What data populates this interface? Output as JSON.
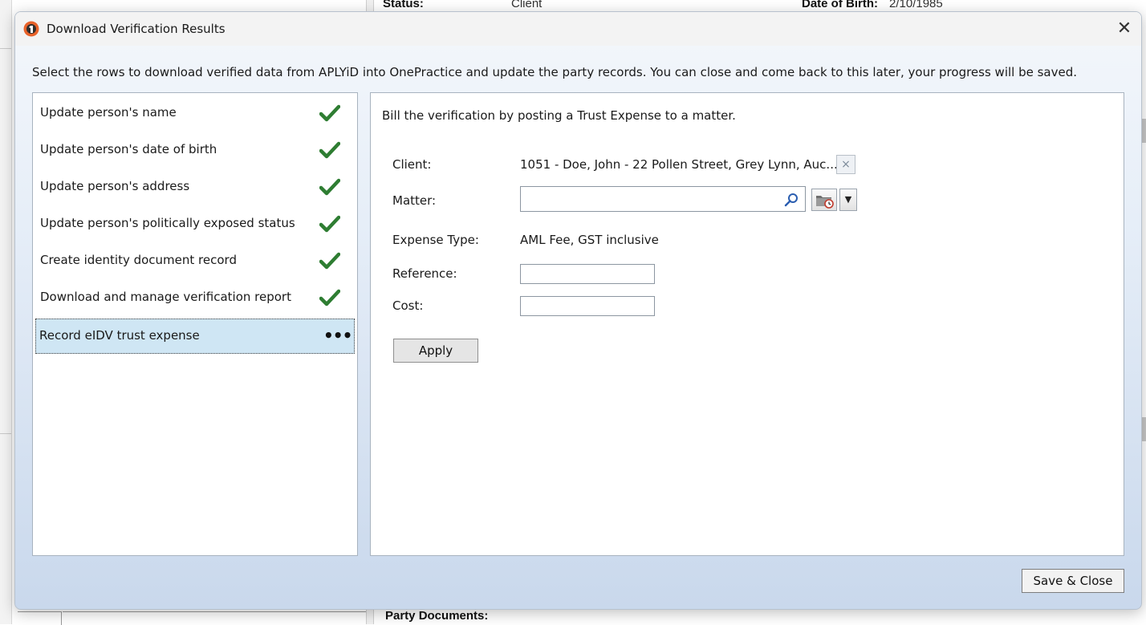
{
  "background": {
    "status_label": "Status:",
    "status_value": "Client",
    "dob_label": "Date of Birth:",
    "dob_value": "2/10/1985",
    "party_documents_label": "Party Documents:"
  },
  "dialog": {
    "title": "Download Verification Results",
    "close_glyph": "✕",
    "instructions": "Select the rows to download verified data from APLYiD into OnePractice and update the party records. You can close and come back to this later, your progress will be saved.",
    "steps": [
      {
        "label": "Update person's name",
        "status": "done"
      },
      {
        "label": "Update person's date of birth",
        "status": "done"
      },
      {
        "label": "Update person's address",
        "status": "done"
      },
      {
        "label": "Update person's politically exposed status",
        "status": "done"
      },
      {
        "label": "Create identity document record",
        "status": "done"
      },
      {
        "label": "Download and manage verification report",
        "status": "done"
      },
      {
        "label": "Record eIDV trust expense",
        "status": "in-progress",
        "status_glyph": "•••"
      }
    ],
    "selected_step": 6,
    "form": {
      "intro": "Bill the verification by posting a Trust Expense to a matter.",
      "client_label": "Client:",
      "client_value": "1051 - Doe, John - 22 Pollen Street, Grey Lynn, Auc...",
      "clear_glyph": "×",
      "matter_label": "Matter:",
      "matter_value": "",
      "expense_type_label": "Expense Type:",
      "expense_type_value": "AML Fee, GST inclusive",
      "reference_label": "Reference:",
      "reference_value": "",
      "cost_label": "Cost:",
      "cost_value": "",
      "apply_label": "Apply",
      "dropdown_glyph": "▼"
    },
    "save_close_label": "Save & Close"
  },
  "colors": {
    "check_green": "#2e7d32",
    "selected_row": "#cfe6f4",
    "dialog_gradient_bottom": "#c9d8ec",
    "app_icon_orange": "#e8622a"
  },
  "icons": {
    "app": "aplyid-app-icon",
    "done": "checkmark-icon",
    "search": "search-icon",
    "folder": "folder-history-icon"
  }
}
